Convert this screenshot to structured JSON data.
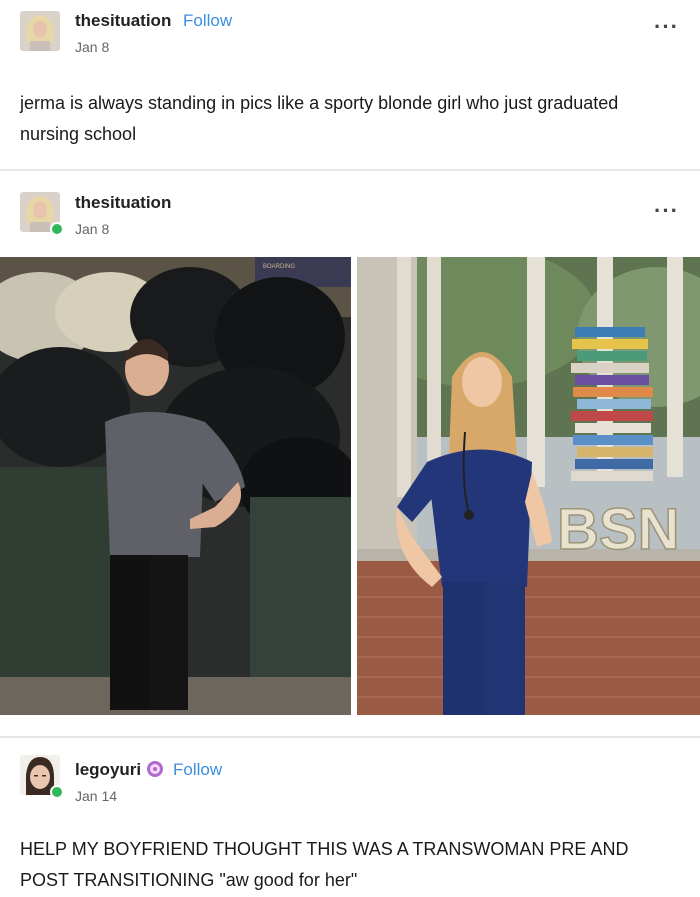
{
  "post1": {
    "username": "thesituation",
    "follow_label": "Follow",
    "date": "Jan 8",
    "menu_icon": "more-dots-icon",
    "text": "jerma is always standing in pics like a sporty blonde girl who just graduated nursing school"
  },
  "post2": {
    "username": "thesituation",
    "date": "Jan 8",
    "menu_icon": "more-dots-icon",
    "photo_left_sign": "BOARDING",
    "photo_right_letters": "BSN"
  },
  "post3": {
    "username": "legoyuri",
    "badge_icon": "pride-badge-icon",
    "follow_label": "Follow",
    "date": "Jan 14",
    "text": "HELP MY BOYFRIEND THOUGHT THIS WAS A TRANSWOMAN PRE AND POST TRANSITIONING \"aw good for her\""
  },
  "colors": {
    "follow_blue": "#3b8fe0",
    "online_green": "#2fb85a"
  }
}
